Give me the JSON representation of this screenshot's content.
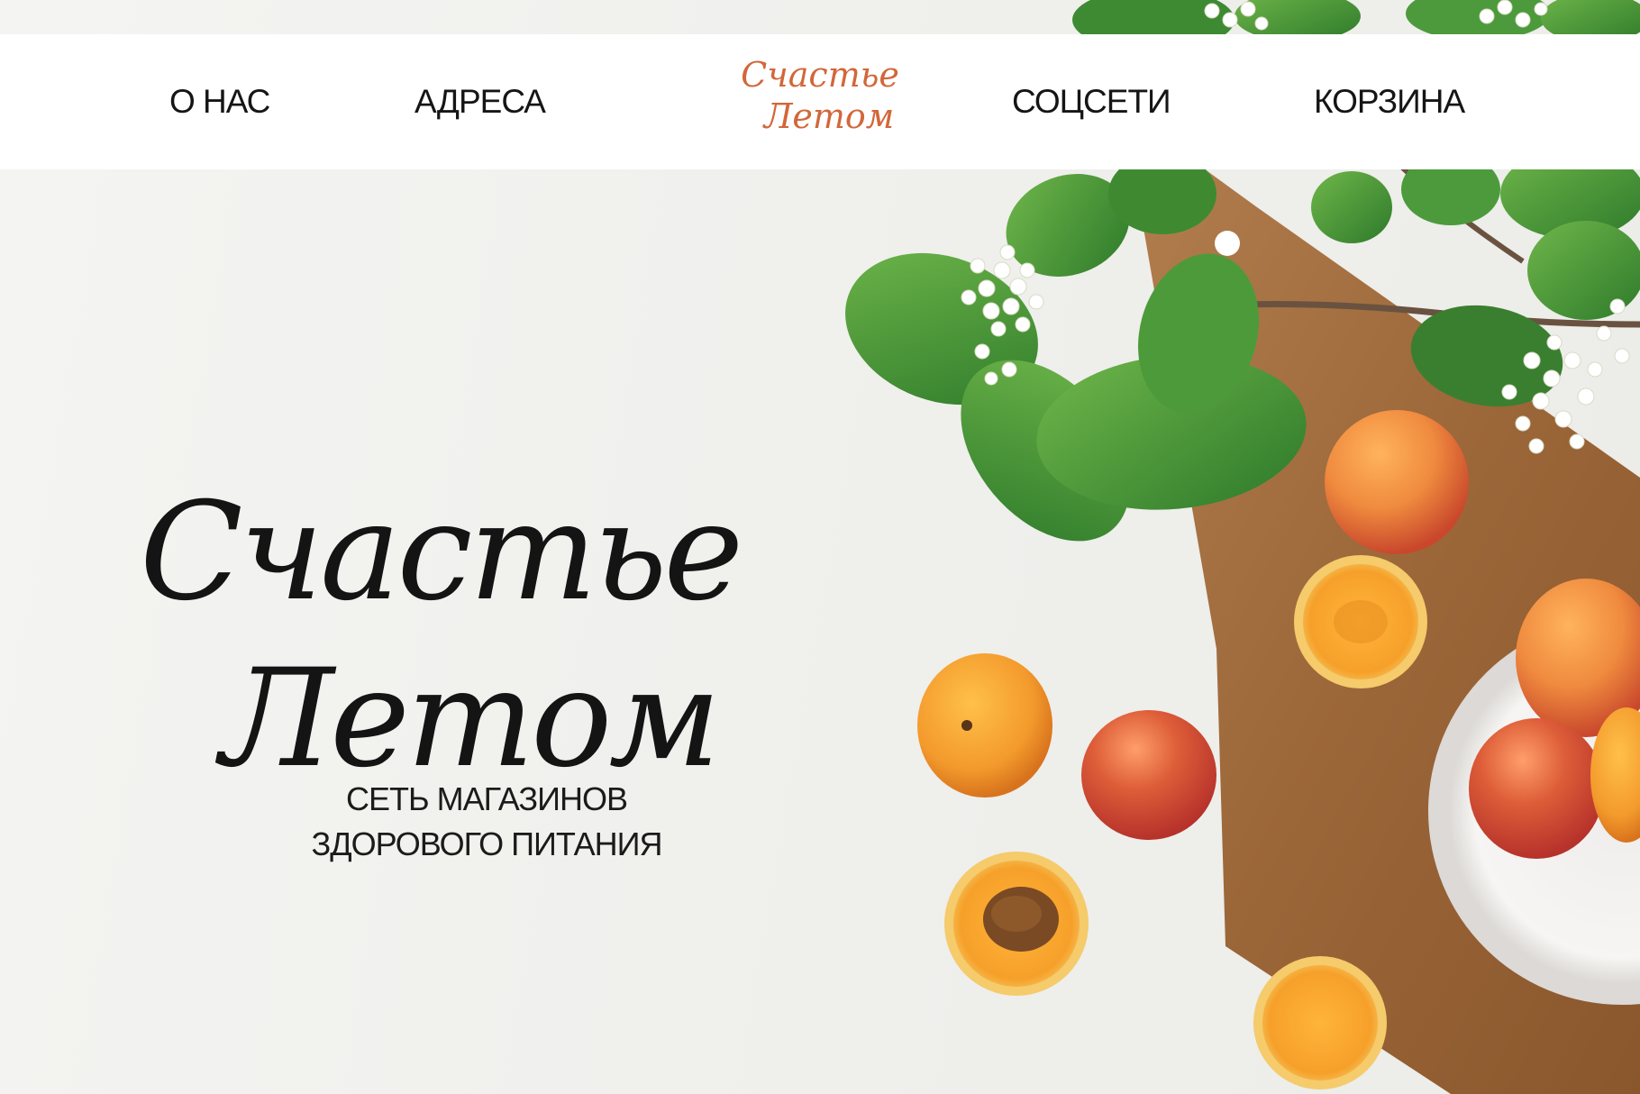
{
  "nav": {
    "items": [
      {
        "label": "О НАС"
      },
      {
        "label": "АДРЕСА"
      },
      {
        "label": "СОЦСЕТИ"
      },
      {
        "label": "КОРЗИНА"
      }
    ],
    "logo": {
      "line1": "Счастье",
      "line2": "Летом"
    }
  },
  "hero": {
    "title_line1": "Счастье",
    "title_line2": "Летом",
    "subtitle_line1": "СЕТЬ МАГАЗИНОВ",
    "subtitle_line2": "ЗДОРОВОГО ПИТАНИЯ"
  },
  "colors": {
    "accent": "#d2673a",
    "background": "#f1f1ef",
    "navbar": "#ffffff",
    "text": "#151515"
  }
}
